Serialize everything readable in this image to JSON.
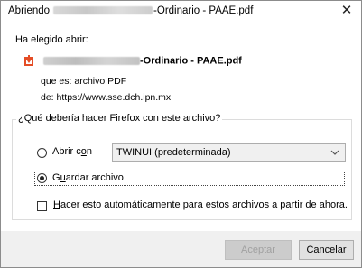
{
  "window": {
    "title_prefix": "Abriendo",
    "title_suffix": "-Ordinario - PAAE.pdf",
    "close_symbol": "✕"
  },
  "content": {
    "heading": "Ha elegido abrir:",
    "file": {
      "icon": "pdf-file-icon",
      "name_suffix": "-Ordinario - PAAE.pdf"
    },
    "type_label": "que es:",
    "type_value": "archivo PDF",
    "from_label": "de:",
    "from_value": "https://www.sse.dch.ipn.mx"
  },
  "choice": {
    "legend": "¿Qué debería hacer Firefox con este archivo?",
    "open_with": {
      "label_a": "Abrir c",
      "label_u": "o",
      "label_b": "n",
      "selected": false
    },
    "app_select": {
      "value": "TWINUI (predeterminada)"
    },
    "save_file": {
      "label_a": "G",
      "label_u": "u",
      "label_b": "ardar archivo",
      "selected": true
    },
    "auto": {
      "label_u": "H",
      "label_b": "acer esto automáticamente para estos archivos a partir de ahora.",
      "checked": false
    }
  },
  "buttons": {
    "accept": "Aceptar",
    "cancel": "Cancelar"
  }
}
